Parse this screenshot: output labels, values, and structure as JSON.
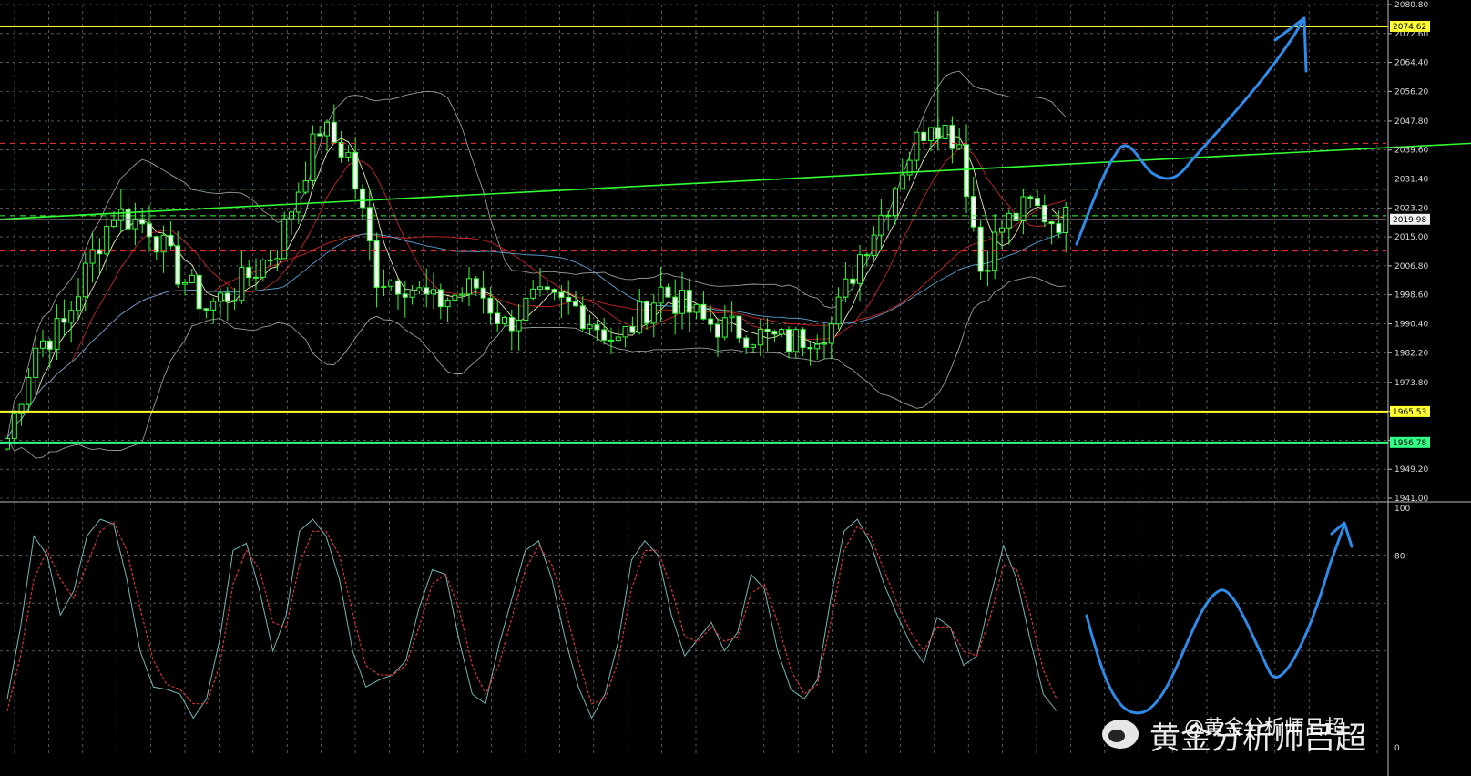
{
  "chart_data": [
    {
      "type": "candlestick",
      "ylim": [
        1941.0,
        2080.8
      ],
      "y_ticks": [
        "2080.80",
        "2072.60",
        "2064.40",
        "2056.20",
        "2047.80",
        "2039.60",
        "2031.40",
        "2023.20",
        "2015.00",
        "2006.80",
        "1998.60",
        "1990.40",
        "1982.20",
        "1973.80",
        "1965.60",
        "1957.40",
        "1949.20",
        "1941.00"
      ],
      "y_tick_values": [
        2080.8,
        2072.6,
        2064.4,
        2056.2,
        2047.8,
        2039.6,
        2031.4,
        2023.2,
        2015.0,
        2006.8,
        1998.6,
        1990.4,
        1982.2,
        1973.8,
        1965.6,
        1957.4,
        1949.2,
        1941.0
      ],
      "grid": true,
      "current_price": {
        "label": "2019.98",
        "value": 2019.98
      },
      "horizontal_levels": [
        {
          "label": "2074.62",
          "value": 2074.62,
          "color": "#ffff33"
        },
        {
          "label": "1965.53",
          "value": 1965.53,
          "color": "#ffff33"
        },
        {
          "label": "1956.78",
          "value": 1956.78,
          "color": "#33ff88"
        }
      ],
      "dashed_levels": [
        {
          "value": 2041.5,
          "color": "#ff3333"
        },
        {
          "value": 2028.5,
          "color": "#33ff33"
        },
        {
          "value": 2021.0,
          "color": "#33ff33"
        },
        {
          "value": 2011.0,
          "color": "#ff3333"
        }
      ],
      "trendline": {
        "from": 2020.0,
        "to": 2041.5,
        "color": "#33ff33"
      },
      "candle_color": "#33ff33",
      "projection_color": "#2f8be8"
    },
    {
      "type": "line",
      "ylim": [
        0,
        100
      ],
      "y_ticks": [
        "100",
        "80",
        "0"
      ],
      "y_tick_values": [
        100,
        80,
        0
      ],
      "grid": true,
      "series": [
        {
          "color": "#6fb8b8",
          "values": [
            20,
            50,
            88,
            80,
            55,
            65,
            88,
            95,
            93,
            70,
            40,
            25,
            24,
            22,
            12,
            20,
            45,
            82,
            85,
            65,
            40,
            55,
            90,
            95,
            88,
            70,
            40,
            25,
            28,
            30,
            36,
            58,
            74,
            72,
            45,
            22,
            18,
            42,
            62,
            82,
            86,
            70,
            45,
            25,
            12,
            22,
            44,
            78,
            86,
            80,
            55,
            38,
            45,
            52,
            40,
            48,
            72,
            66,
            40,
            24,
            20,
            28,
            62,
            90,
            95,
            85,
            68,
            55,
            43,
            35,
            54,
            50,
            34,
            38,
            62,
            84,
            70,
            45,
            22,
            15
          ]
        },
        {
          "color": "#dd3333",
          "values": [
            15,
            38,
            70,
            82,
            70,
            62,
            76,
            90,
            94,
            82,
            58,
            36,
            26,
            24,
            18,
            18,
            34,
            68,
            82,
            74,
            52,
            50,
            76,
            90,
            90,
            80,
            56,
            34,
            30,
            30,
            34,
            50,
            68,
            72,
            58,
            34,
            22,
            34,
            54,
            74,
            84,
            76,
            58,
            36,
            18,
            20,
            36,
            66,
            82,
            82,
            66,
            46,
            44,
            50,
            44,
            46,
            64,
            68,
            52,
            32,
            22,
            26,
            52,
            82,
            92,
            88,
            74,
            60,
            48,
            40,
            50,
            50,
            40,
            38,
            54,
            76,
            74,
            56,
            32,
            20
          ]
        }
      ]
    }
  ],
  "watermark": {
    "text": "黄金分析师吕超",
    "handle": "@黄金分析师吕超"
  }
}
